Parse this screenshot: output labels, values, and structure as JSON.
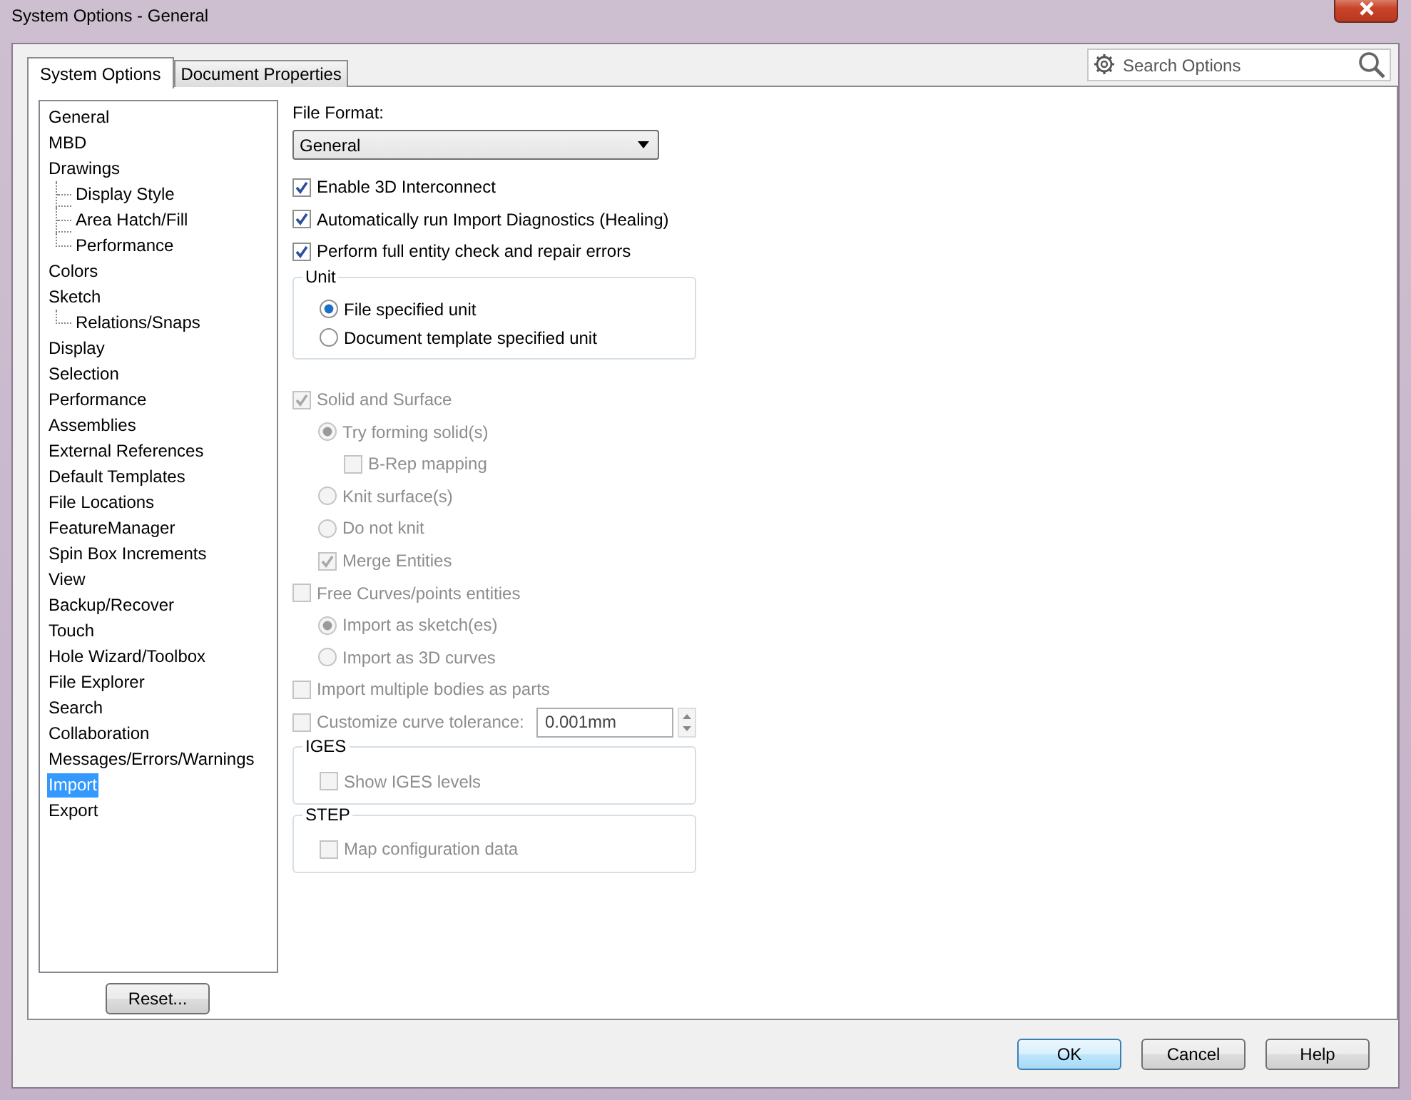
{
  "window": {
    "title": "System Options - General"
  },
  "tabs": [
    {
      "label": "System Options",
      "selected": true
    },
    {
      "label": "Document Properties",
      "selected": false
    }
  ],
  "search": {
    "placeholder": "Search Options"
  },
  "tree": [
    {
      "label": "General",
      "selected": false
    },
    {
      "label": "MBD",
      "selected": false
    },
    {
      "label": "Drawings",
      "selected": false,
      "children": [
        {
          "label": "Display Style",
          "selected": false
        },
        {
          "label": "Area Hatch/Fill",
          "selected": false
        },
        {
          "label": "Performance",
          "selected": false
        }
      ]
    },
    {
      "label": "Colors",
      "selected": false
    },
    {
      "label": "Sketch",
      "selected": false,
      "children": [
        {
          "label": "Relations/Snaps",
          "selected": false
        }
      ]
    },
    {
      "label": "Display",
      "selected": false
    },
    {
      "label": "Selection",
      "selected": false
    },
    {
      "label": "Performance",
      "selected": false
    },
    {
      "label": "Assemblies",
      "selected": false
    },
    {
      "label": "External References",
      "selected": false
    },
    {
      "label": "Default Templates",
      "selected": false
    },
    {
      "label": "File Locations",
      "selected": false
    },
    {
      "label": "FeatureManager",
      "selected": false
    },
    {
      "label": "Spin Box Increments",
      "selected": false
    },
    {
      "label": "View",
      "selected": false
    },
    {
      "label": "Backup/Recover",
      "selected": false
    },
    {
      "label": "Touch",
      "selected": false
    },
    {
      "label": "Hole Wizard/Toolbox",
      "selected": false
    },
    {
      "label": "File Explorer",
      "selected": false
    },
    {
      "label": "Search",
      "selected": false
    },
    {
      "label": "Collaboration",
      "selected": false
    },
    {
      "label": "Messages/Errors/Warnings",
      "selected": false
    },
    {
      "label": "Import",
      "selected": true
    },
    {
      "label": "Export",
      "selected": false
    }
  ],
  "reset_button": "Reset...",
  "file_format": {
    "label": "File Format:",
    "value": "General"
  },
  "options": [
    {
      "kind": "checkbox",
      "label": "Enable 3D Interconnect",
      "checked": true,
      "disabled": false
    },
    {
      "kind": "checkbox",
      "label": "Automatically run Import Diagnostics (Healing)",
      "checked": true,
      "disabled": false
    },
    {
      "kind": "checkbox",
      "label": "Perform full entity check and repair errors",
      "checked": true,
      "disabled": false
    },
    {
      "kind": "group",
      "title": "Unit",
      "children": [
        {
          "kind": "radio",
          "label": "File specified unit",
          "selected": true,
          "disabled": false
        },
        {
          "kind": "radio",
          "label": "Document template specified unit",
          "selected": false,
          "disabled": false
        }
      ]
    },
    {
      "kind": "checkbox",
      "label": "Solid and Surface",
      "checked": true,
      "disabled": true,
      "children": [
        {
          "kind": "radio",
          "label": "Try forming solid(s)",
          "selected": true,
          "disabled": true,
          "children": [
            {
              "kind": "checkbox",
              "label": "B-Rep mapping",
              "checked": false,
              "disabled": true
            }
          ]
        },
        {
          "kind": "radio",
          "label": "Knit surface(s)",
          "selected": false,
          "disabled": true
        },
        {
          "kind": "radio",
          "label": "Do not knit",
          "selected": false,
          "disabled": true
        },
        {
          "kind": "checkbox",
          "label": "Merge Entities",
          "checked": true,
          "disabled": true
        }
      ]
    },
    {
      "kind": "checkbox",
      "label": "Free Curves/points entities",
      "checked": false,
      "disabled": true,
      "children": [
        {
          "kind": "radio",
          "label": "Import as sketch(es)",
          "selected": true,
          "disabled": true
        },
        {
          "kind": "radio",
          "label": "Import as 3D curves",
          "selected": false,
          "disabled": true
        }
      ]
    },
    {
      "kind": "checkbox",
      "label": "Import multiple bodies as parts",
      "checked": false,
      "disabled": true
    },
    {
      "kind": "tolerance",
      "label": "Customize curve tolerance:",
      "checked": false,
      "disabled": true,
      "value": "0.001mm"
    },
    {
      "kind": "group",
      "title": "IGES",
      "children": [
        {
          "kind": "checkbox",
          "label": "Show IGES levels",
          "checked": false,
          "disabled": true
        }
      ]
    },
    {
      "kind": "group",
      "title": "STEP",
      "children": [
        {
          "kind": "checkbox",
          "label": "Map configuration data",
          "checked": false,
          "disabled": true
        }
      ]
    }
  ],
  "buttons": [
    {
      "label": "OK",
      "default": true
    },
    {
      "label": "Cancel",
      "default": false
    },
    {
      "label": "Help",
      "default": false
    }
  ]
}
